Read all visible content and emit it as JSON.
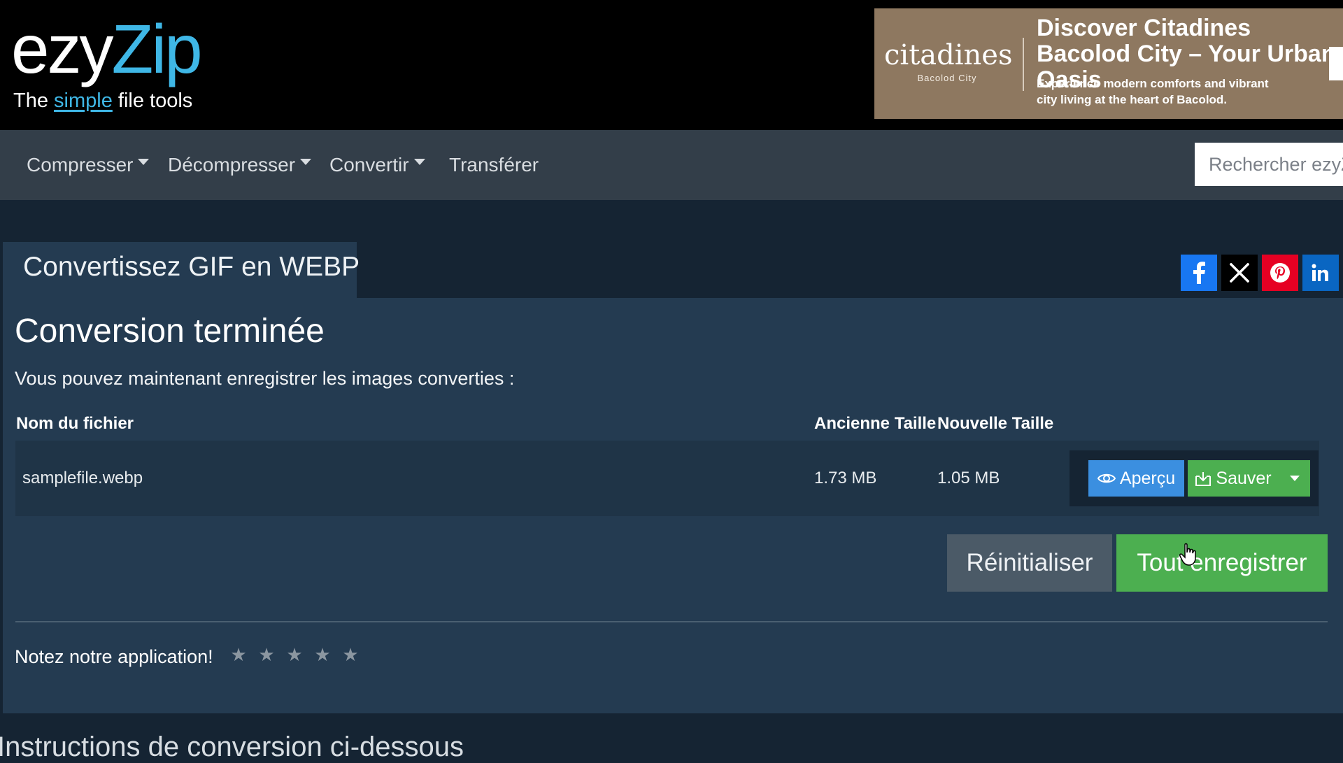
{
  "header": {
    "logo": {
      "word1": "ezy",
      "word2": "Zip",
      "tag_before": "The ",
      "tag_highlight": "simple",
      "tag_after": " file tools"
    },
    "ad": {
      "brand": "citadines",
      "brand_sub": "Bacolod City",
      "title": "Discover Citadines Bacolod City – Your Urban Oasis",
      "description": "Experience modern comforts and vibrant city living at the heart of Bacolod."
    }
  },
  "nav": {
    "items": [
      {
        "label": "Compresser",
        "has_caret": true
      },
      {
        "label": "Décompresser",
        "has_caret": true
      },
      {
        "label": "Convertir",
        "has_caret": true
      },
      {
        "label": "Transférer",
        "has_caret": false
      }
    ],
    "search_placeholder": "Rechercher ezyZip"
  },
  "page": {
    "tab_title": "Convertissez GIF en WEBP",
    "share": [
      "facebook-icon",
      "x-twitter-icon",
      "pinterest-icon",
      "linkedin-icon"
    ],
    "heading": "Conversion terminée",
    "subtitle": "Vous pouvez maintenant enregistrer les images converties :",
    "table": {
      "headers": {
        "filename": "Nom du fichier",
        "old_size": "Ancienne Taille",
        "new_size": "Nouvelle Taille"
      },
      "rows": [
        {
          "filename": "samplefile.webp",
          "old_size": "1.73 MB",
          "new_size": "1.05 MB"
        }
      ],
      "preview_label": "Aperçu",
      "save_label": "Sauver"
    },
    "reset_label": "Réinitialiser",
    "save_all_label": "Tout enregistrer",
    "rating": {
      "label": "Notez notre application!",
      "stars": [
        "★",
        "★",
        "★",
        "★",
        "★"
      ]
    },
    "footer_heading": "Instructions de conversion ci-dessous"
  },
  "colors": {
    "accent_blue": "#3fb7e6",
    "primary_button": "#3b8fe0",
    "success_button": "#4caf50",
    "facebook": "#1877f2",
    "pinterest": "#e60023",
    "linkedin": "#0a66c2"
  }
}
